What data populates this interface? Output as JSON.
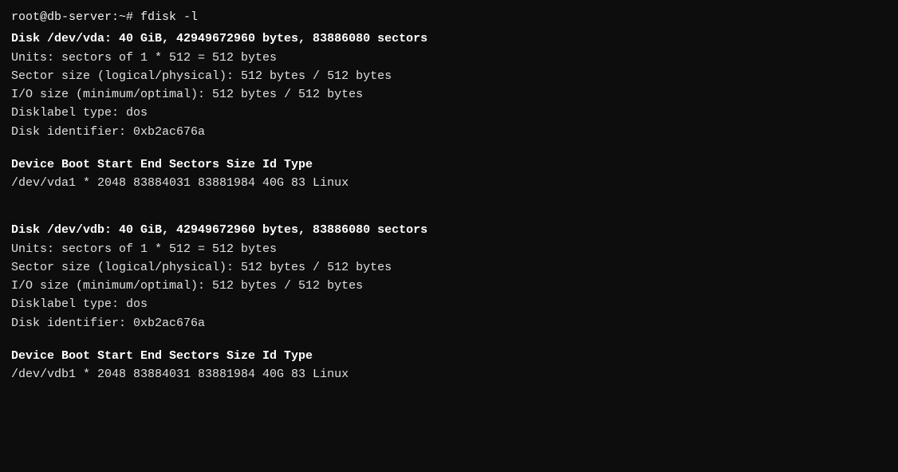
{
  "terminal": {
    "prompt": "root@db-server:~# fdisk -l",
    "disk_vda": {
      "header": "Disk /dev/vda: 40 GiB, 42949672960 bytes, 83886080 sectors",
      "units": "Units: sectors of 1 * 512 = 512 bytes",
      "sector_size": "Sector size (logical/physical): 512 bytes / 512 bytes",
      "io_size": "I/O size (minimum/optimal): 512 bytes / 512 bytes",
      "disklabel_type": "Disklabel type: dos",
      "disk_identifier": "Disk identifier: 0xb2ac676a",
      "table_header": "Device      Boot  Start       End   Sectors  Size Id Type",
      "partition": "/dev/vda1   *      2048  83884031  83881984   40G 83 Linux"
    },
    "disk_vdb": {
      "header": "Disk /dev/vdb: 40 GiB, 42949672960 bytes, 83886080 sectors",
      "units": "Units: sectors of 1 * 512 = 512 bytes",
      "sector_size": "Sector size (logical/physical): 512 bytes / 512 bytes",
      "io_size": "I/O size (minimum/optimal): 512 bytes / 512 bytes",
      "disklabel_type": "Disklabel type: dos",
      "disk_identifier": "Disk identifier: 0xb2ac676a",
      "table_header": "Device      Boot  Start       End   Sectors  Size Id Type",
      "partition": "/dev/vdb1   *      2048  83884031  83881984   40G 83 Linux"
    }
  }
}
